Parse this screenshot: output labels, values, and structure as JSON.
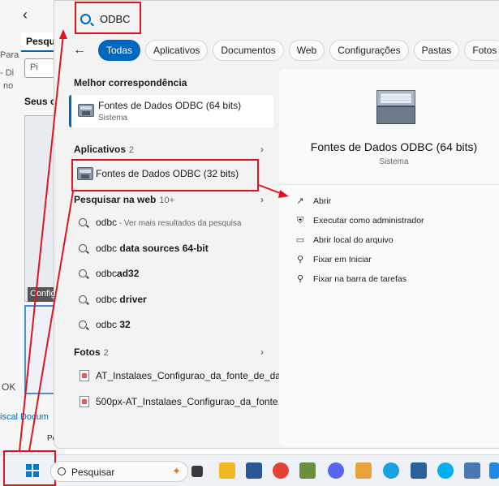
{
  "background_window": {
    "back_label": "‹",
    "tab_label": "Pesqu",
    "para_text": "Para",
    "search_placeholder": "Pi",
    "di_text": "- Di",
    "no_text": "no",
    "seus_title": "Seus c",
    "thumb_caption": "Config",
    "ok_text": "OK",
    "links_text": "iscal  Docum"
  },
  "search": {
    "query": "ODBC"
  },
  "filters": {
    "back_icon": "arrow-left-icon",
    "chips": [
      "Todas",
      "Aplicativos",
      "Documentos",
      "Web",
      "Configurações",
      "Pastas",
      "Fotos"
    ],
    "active": "Todas",
    "more_icon": "play-icon"
  },
  "best_match": {
    "section_title": "Melhor correspondência",
    "title": "Fontes de Dados ODBC (64 bits)",
    "subtitle": "Sistema"
  },
  "apps": {
    "section_title": "Aplicativos",
    "count": "2",
    "items": [
      {
        "title": "Fontes de Dados ODBC (32 bits)"
      }
    ]
  },
  "web": {
    "section_title": "Pesquisar na web",
    "count": "10+",
    "items": [
      {
        "plain": "odbc",
        "bold": "",
        "muted": " - Ver mais resultados da pesquisa"
      },
      {
        "plain": "odbc ",
        "bold": "data sources 64-bit",
        "muted": ""
      },
      {
        "plain": "odbc",
        "bold": "ad32",
        "muted": ""
      },
      {
        "plain": "odbc ",
        "bold": "driver",
        "muted": ""
      },
      {
        "plain": "odbc ",
        "bold": "32",
        "muted": ""
      }
    ]
  },
  "photos": {
    "section_title": "Fotos",
    "count": "2",
    "items": [
      {
        "title": "AT_Instalaes_Configurao_da_fonte_de_da..."
      },
      {
        "title": "500px-AT_Instalaes_Configurao_da_fonte..."
      }
    ]
  },
  "detail": {
    "title": "Fontes de Dados ODBC (64 bits)",
    "subtitle": "Sistema",
    "actions": [
      {
        "label": "Abrir",
        "icon": "open-external-icon"
      },
      {
        "label": "Executar como administrador",
        "icon": "admin-shield-icon"
      },
      {
        "label": "Abrir local do arquivo",
        "icon": "folder-icon"
      },
      {
        "label": "Fixar em Iniciar",
        "icon": "pin-icon"
      },
      {
        "label": "Fixar na barra de tarefas",
        "icon": "pin-icon"
      }
    ]
  },
  "taskbar": {
    "search_placeholder": "Pesquisar",
    "bg_tooltip": "Pe",
    "icons": [
      "task-view-icon",
      "file-explorer-icon",
      "store-icon",
      "chrome-icon",
      "app-icon",
      "discord-icon",
      "snipping-icon",
      "edge-icon",
      "network-icon",
      "skype-icon",
      "notepad-icon",
      "app-icon-blue"
    ]
  },
  "colors": {
    "accent": "#0067c0",
    "highlight": "#e0141e"
  }
}
